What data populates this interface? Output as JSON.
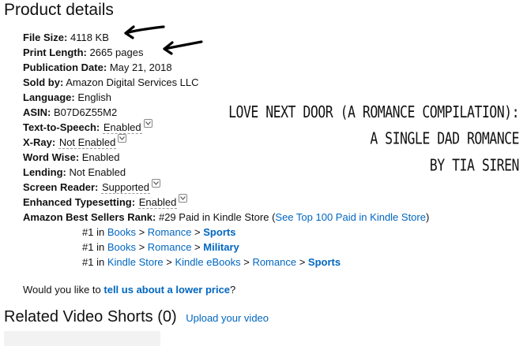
{
  "heading": "Product details",
  "details": [
    {
      "label": "File Size:",
      "value": "4118 KB"
    },
    {
      "label": "Print Length:",
      "value": "2665 pages"
    },
    {
      "label": "Publication Date:",
      "value": "May 21, 2018"
    },
    {
      "label": "Sold by:",
      "value": "Amazon Digital Services LLC"
    },
    {
      "label": "Language:",
      "value": "English"
    },
    {
      "label": "ASIN:",
      "value": "B07D6Z55M2"
    },
    {
      "label": "Text-to-Speech:",
      "value": "Enabled"
    },
    {
      "label": "X-Ray:",
      "value": "Not Enabled"
    },
    {
      "label": "Word Wise:",
      "value": "Enabled"
    },
    {
      "label": "Lending:",
      "value": "Not Enabled"
    },
    {
      "label": "Screen Reader:",
      "value": "Supported"
    },
    {
      "label": "Enhanced Typesetting:",
      "value": "Enabled"
    }
  ],
  "rank": {
    "label": "Amazon Best Sellers Rank:",
    "value": "#29 Paid in Kindle Store (",
    "top_link": "See Top 100 Paid in Kindle Store",
    "close": ")",
    "sub": [
      {
        "pos": "#1 in",
        "path": [
          "Books",
          "Romance"
        ],
        "leaf": "Sports"
      },
      {
        "pos": "#1 in",
        "path": [
          "Books",
          "Romance"
        ],
        "leaf": "Military"
      },
      {
        "pos": "#1 in",
        "path": [
          "Kindle Store",
          "Kindle eBooks",
          "Romance"
        ],
        "leaf": "Sports"
      }
    ]
  },
  "lower_price": {
    "prefix": "Would you like to",
    "link": "tell us about a lower price",
    "suffix": "?"
  },
  "related": {
    "title": "Related Video Shorts (0)",
    "upload": "Upload your video"
  },
  "overlay_text": {
    "line1": "LOVE NEXT DOOR (A ROMANCE COMPILATION):",
    "line2": "A SINGLE DAD ROMANCE",
    "line3": "BY TIA SIREN"
  },
  "icons": [
    "arrow-left-icon",
    "dropdown-chevron-icon"
  ],
  "colors": {
    "link": "#0066c0",
    "text": "#111111"
  }
}
